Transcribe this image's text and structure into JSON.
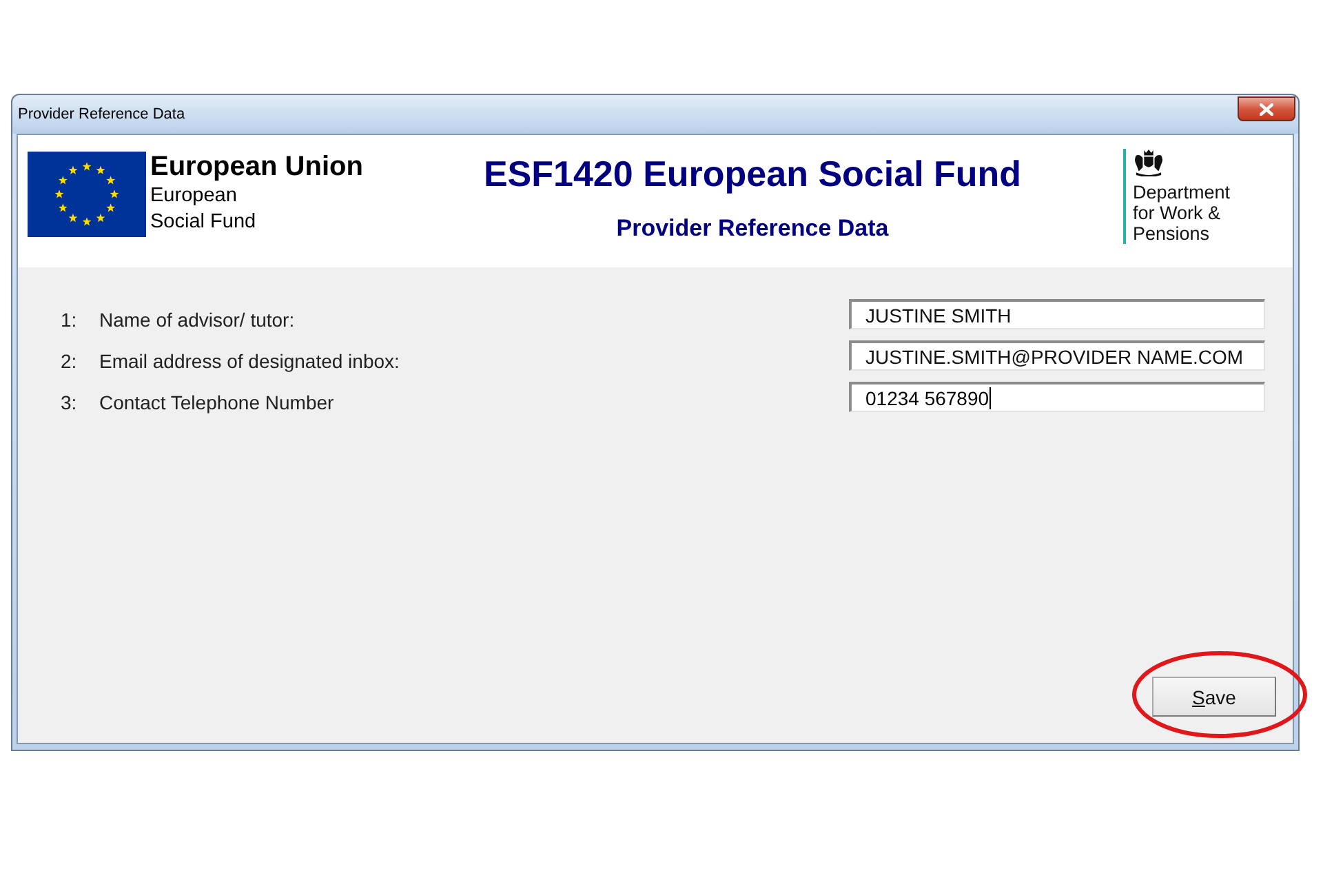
{
  "window": {
    "title": "Provider Reference Data"
  },
  "header": {
    "org_name": "European Union",
    "org_subtitle": [
      "European",
      "Social Fund"
    ],
    "title": "ESF1420 European Social Fund",
    "subtitle": "Provider Reference Data",
    "department": [
      "Department",
      "for Work &",
      "Pensions"
    ]
  },
  "fields": [
    {
      "number": "1:",
      "label": "Name of advisor/ tutor:",
      "value": "JUSTINE SMITH",
      "focused": false
    },
    {
      "number": "2:",
      "label": "Email address of designated inbox:",
      "value": "JUSTINE.SMITH@PROVIDER NAME.COM",
      "focused": false
    },
    {
      "number": "3:",
      "label": "Contact Telephone Number",
      "value": "01234 567890",
      "focused": true
    }
  ],
  "buttons": [
    {
      "label": "Save"
    }
  ]
}
